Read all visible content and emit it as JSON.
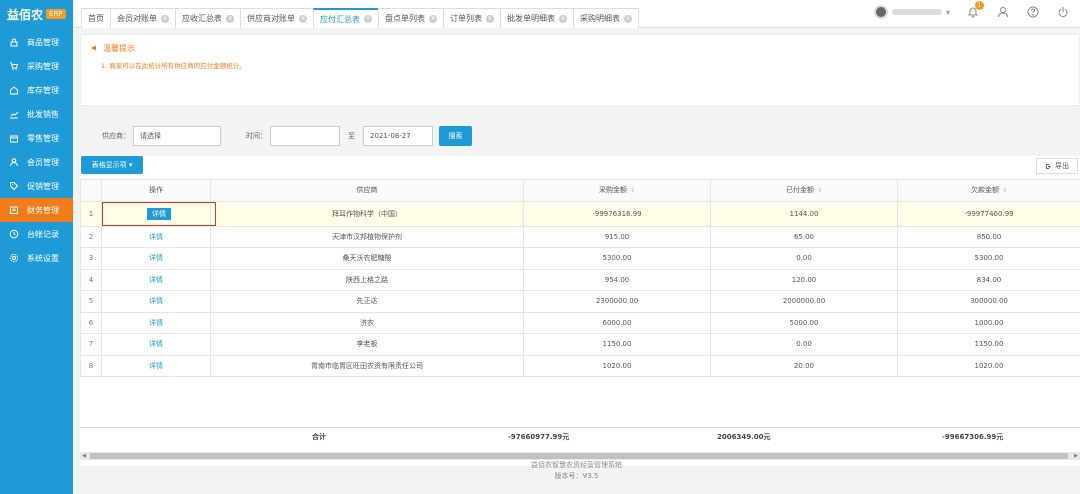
{
  "brand": {
    "name": "益佰农",
    "badge": "ERP"
  },
  "sidebar": {
    "items": [
      {
        "label": "商品管理",
        "icon": "lock-icon"
      },
      {
        "label": "采购管理",
        "icon": "cart-icon"
      },
      {
        "label": "库存管理",
        "icon": "home-icon"
      },
      {
        "label": "批发销售",
        "icon": "chart-icon"
      },
      {
        "label": "零售管理",
        "icon": "store-icon"
      },
      {
        "label": "会员管理",
        "icon": "user-icon"
      },
      {
        "label": "促销管理",
        "icon": "tag-icon"
      },
      {
        "label": "财务管理",
        "icon": "finance-icon",
        "active": true
      },
      {
        "label": "台帐记录",
        "icon": "clock-icon"
      },
      {
        "label": "系统设置",
        "icon": "gear-icon"
      }
    ]
  },
  "tabs": [
    {
      "label": "首页",
      "closable": false
    },
    {
      "label": "会员对账单",
      "closable": true
    },
    {
      "label": "应收汇总表",
      "closable": true
    },
    {
      "label": "供应商对账单",
      "closable": true
    },
    {
      "label": "应付汇总表",
      "closable": true,
      "active": true
    },
    {
      "label": "盘点单列表",
      "closable": true
    },
    {
      "label": "订单列表",
      "closable": true
    },
    {
      "label": "批发单明细表",
      "closable": true
    },
    {
      "label": "采购明细表",
      "closable": true
    }
  ],
  "topbar": {
    "notification_count": "1",
    "user_caret": "▾"
  },
  "tip": {
    "title": "温馨提示",
    "text": "1. 商家可以在此统计所有供应商的应付金额统计。"
  },
  "filter": {
    "supplier_label": "供应商：",
    "supplier_value": "请选择",
    "time_label": "时间：",
    "time_start": "",
    "to_label": "至",
    "time_end": "2021-08-27",
    "search_label": "搜索"
  },
  "toolbar": {
    "display_label": "表格显示项 ▾",
    "export_label": "导出"
  },
  "table": {
    "columns": [
      "",
      "操作",
      "供应商",
      "采购金额",
      "已付金额",
      "欠款金额"
    ],
    "rows": [
      {
        "n": "1",
        "action": "详情",
        "supplier": "拜耳作物科学（中国）",
        "purchase": "-99976316.99",
        "paid": "1144.00",
        "owed": "-99977460.99"
      },
      {
        "n": "2",
        "action": "详情",
        "supplier": "天津市汉邦植物保护剂",
        "purchase": "915.00",
        "paid": "65.00",
        "owed": "850.00"
      },
      {
        "n": "3",
        "action": "详情",
        "supplier": "桑天沃农肥糖酸",
        "purchase": "5300.00",
        "paid": "0.00",
        "owed": "5300.00"
      },
      {
        "n": "4",
        "action": "详情",
        "supplier": "陕西上格之路",
        "purchase": "954.00",
        "paid": "120.00",
        "owed": "834.00"
      },
      {
        "n": "5",
        "action": "详情",
        "supplier": "先正达",
        "purchase": "2300000.00",
        "paid": "2000000.00",
        "owed": "300000.00"
      },
      {
        "n": "6",
        "action": "详情",
        "supplier": "济农",
        "purchase": "6000.00",
        "paid": "5000.00",
        "owed": "1000.00"
      },
      {
        "n": "7",
        "action": "详情",
        "supplier": "李老板",
        "purchase": "1150.00",
        "paid": "0.00",
        "owed": "1150.00"
      },
      {
        "n": "8",
        "action": "详情",
        "supplier": "胃南市临胃区旺田农资有限责任公司",
        "purchase": "1020.00",
        "paid": "20.00",
        "owed": "1020.00"
      }
    ],
    "sum": {
      "label": "合计",
      "purchase": "-97660977.99元",
      "paid": "2006349.00元",
      "owed": "-99667306.99元"
    }
  },
  "footer": {
    "line1": "益佰农智慧农资经营管理系统",
    "line2": "版本号：V3.5"
  }
}
